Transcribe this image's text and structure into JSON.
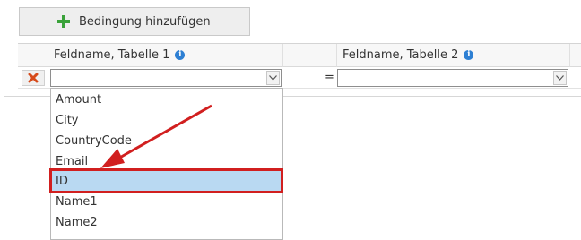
{
  "toolbar": {
    "add_condition_label": "Bedingung hinzufügen",
    "add_icon": "plus-icon"
  },
  "grid": {
    "columns": [
      {
        "label": "Feldname, Tabelle 1",
        "info_icon": "info-icon"
      },
      {
        "label": "Feldname, Tabelle 2",
        "info_icon": "info-icon"
      }
    ],
    "row": {
      "delete_icon": "delete-x-icon",
      "left_value": "",
      "operator": "=",
      "right_value": ""
    }
  },
  "dropdown": {
    "options": [
      "Amount",
      "City",
      "CountryCode",
      "Email",
      "ID",
      "Name1",
      "Name2"
    ],
    "selected": "ID"
  },
  "colors": {
    "accent": "#2d7fd3",
    "highlight": "#d11f1f",
    "selection": "#b9d9f2",
    "add_icon": "#3aa23a"
  }
}
